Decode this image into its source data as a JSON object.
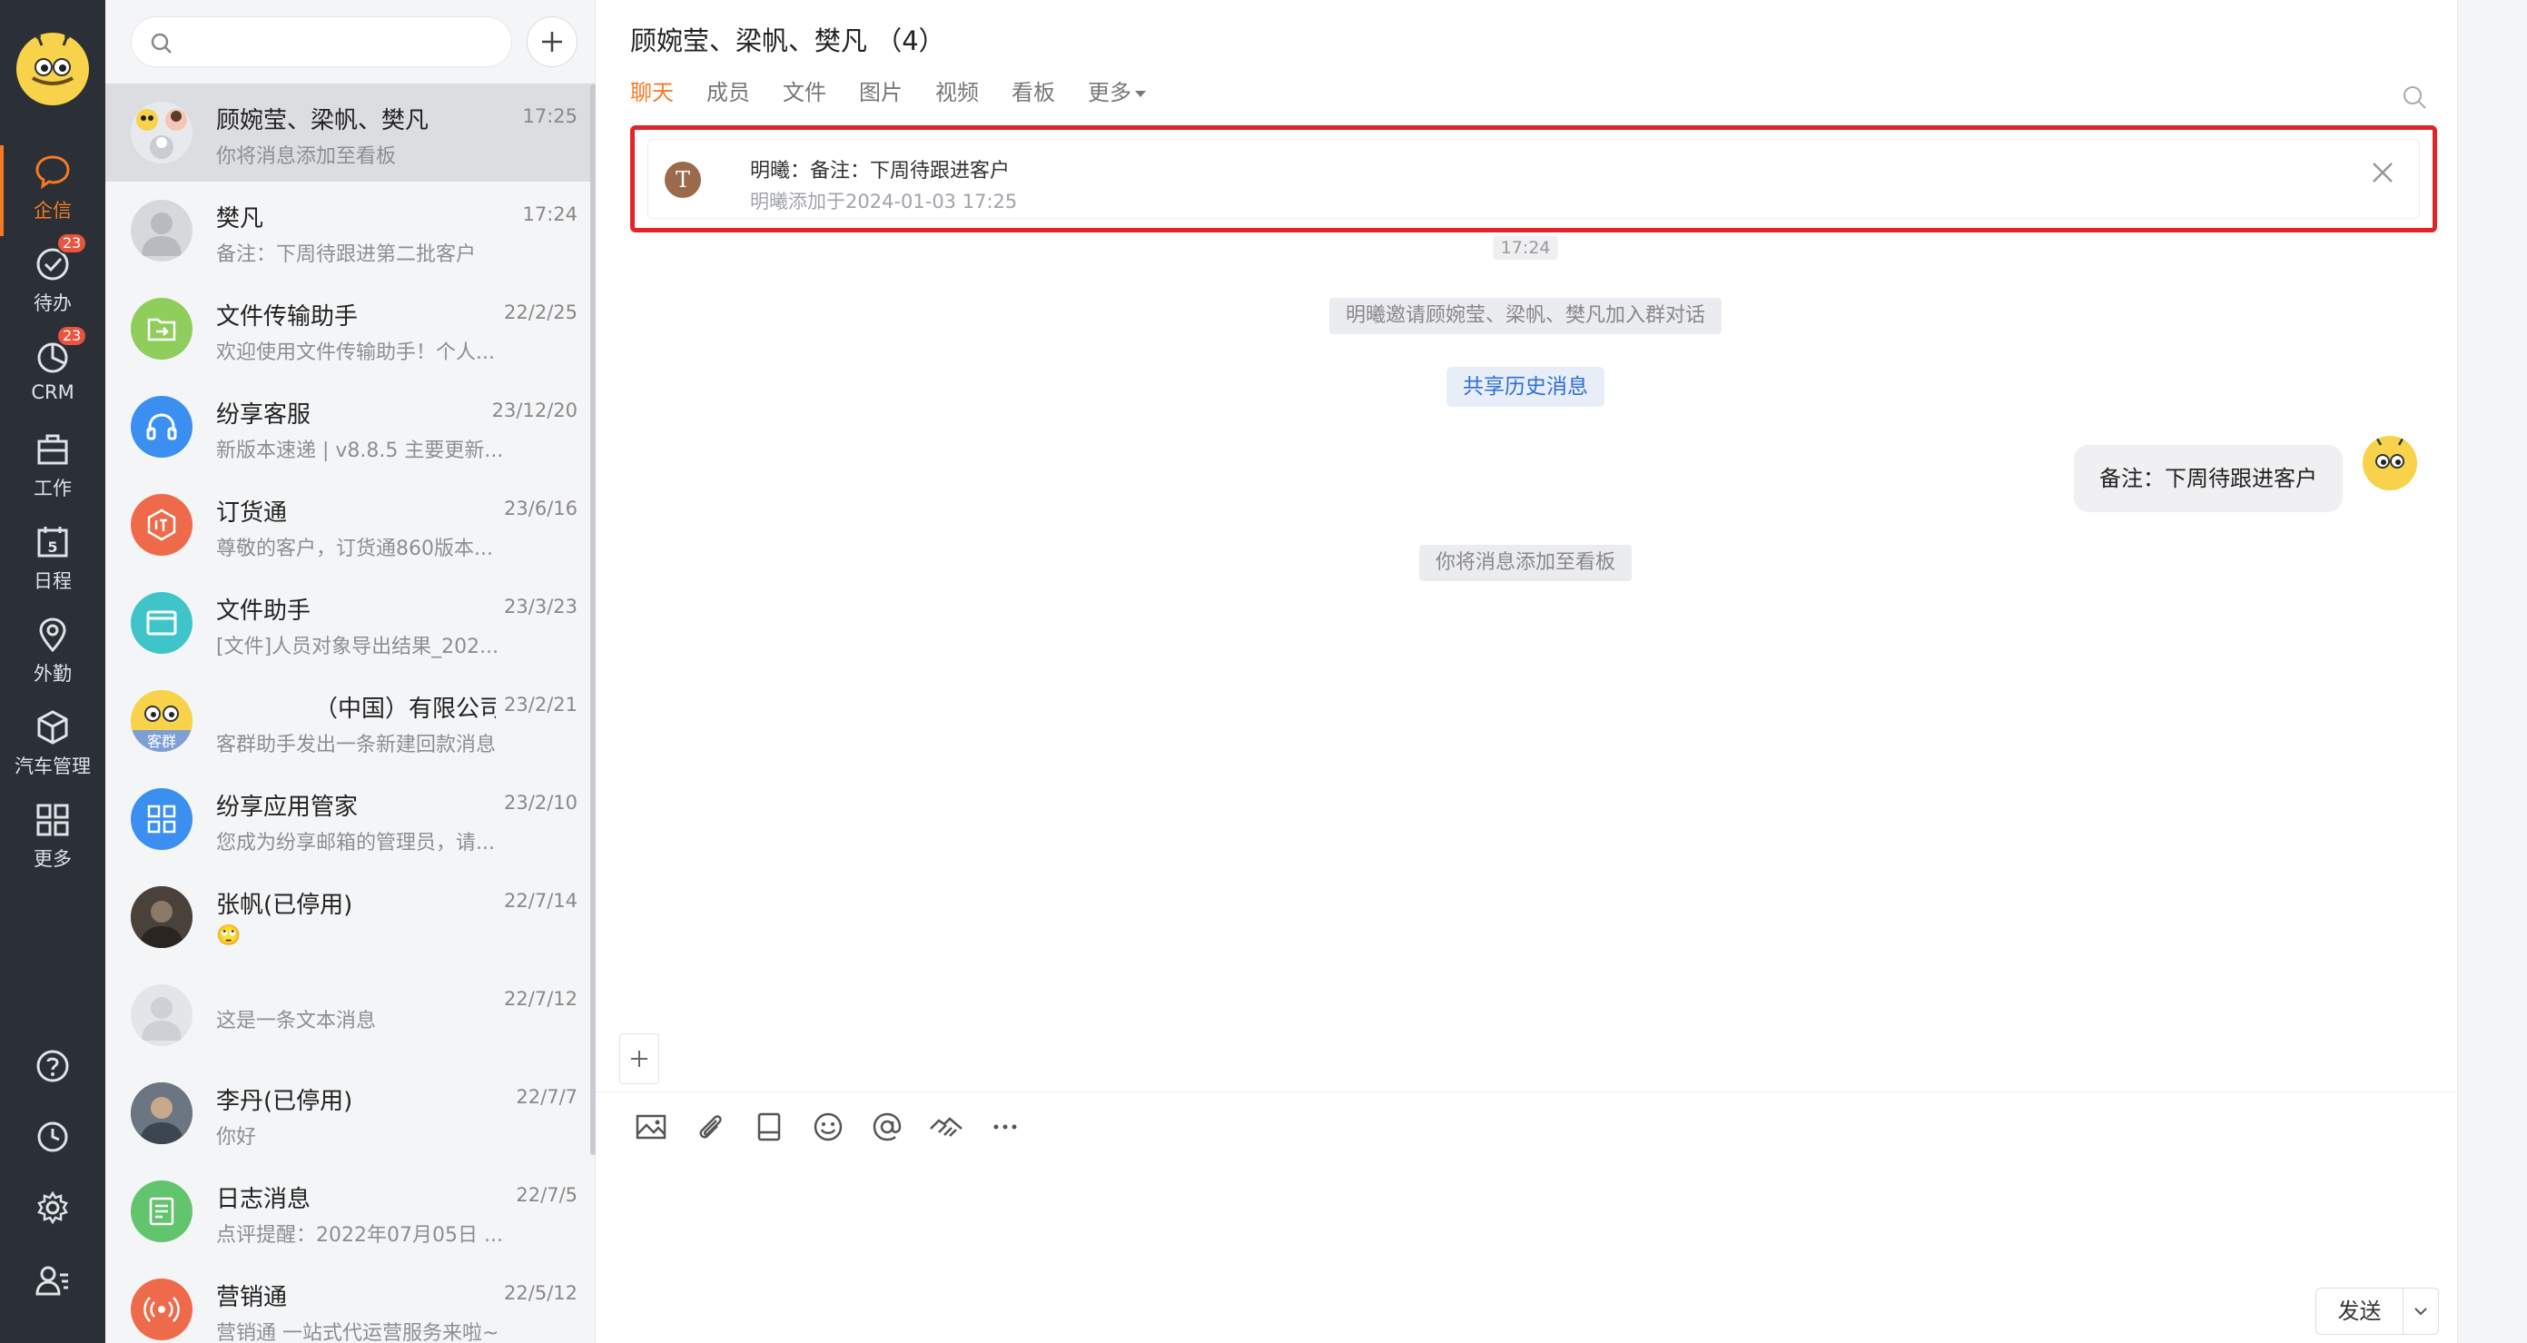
{
  "nav": {
    "items": [
      {
        "label": "企信",
        "icon": "chat-bubble-icon",
        "active": true
      },
      {
        "label": "待办",
        "icon": "check-circle-icon",
        "badge": "23"
      },
      {
        "label": "CRM",
        "icon": "pie-chart-icon",
        "badge": "23"
      },
      {
        "label": "工作",
        "icon": "briefcase-icon"
      },
      {
        "label": "日程",
        "icon": "calendar-icon",
        "day": "5"
      },
      {
        "label": "外勤",
        "icon": "location-pin-icon"
      },
      {
        "label": "汽车管理",
        "icon": "cube-icon"
      },
      {
        "label": "更多",
        "icon": "grid-icon"
      }
    ],
    "bottom": [
      {
        "icon": "help-icon"
      },
      {
        "icon": "clock-icon"
      },
      {
        "icon": "settings-icon"
      },
      {
        "icon": "user-list-icon"
      }
    ]
  },
  "search": {
    "placeholder": "",
    "value": ""
  },
  "conversations": [
    {
      "name": "顾婉莹、梁帆、樊凡",
      "time": "17:25",
      "preview": "你将消息添加至看板",
      "avatar": "group",
      "active": true
    },
    {
      "name": "樊凡",
      "time": "17:24",
      "preview": "备注：下周待跟进第二批客户",
      "avatar": "person-gray"
    },
    {
      "name": "文件传输助手",
      "time": "22/2/25",
      "preview": "欢迎使用文件传输助手！个人...",
      "avatar": "file-transfer",
      "color": "#8fce5d"
    },
    {
      "name": "纷享客服",
      "time": "23/12/20",
      "preview": "新版本速递 | v8.8.5 主要更新...",
      "avatar": "headset",
      "color": "#3b8ff0"
    },
    {
      "name": "订货通",
      "time": "23/6/16",
      "preview": "尊敬的客户，订货通860版本...",
      "avatar": "order",
      "color": "#ef6a4a"
    },
    {
      "name": "文件助手",
      "time": "23/3/23",
      "preview": "[文件]人员对象导出结果_202...",
      "avatar": "folder",
      "color": "#3fc5c9"
    },
    {
      "name": "（中国）有限公司",
      "time": "23/2/21",
      "preview": "客群助手发出一条新建回款消息",
      "avatar": "bee-group",
      "badge_text": "客群"
    },
    {
      "name": "纷享应用管家",
      "time": "23/2/10",
      "preview": "您成为纷享邮箱的管理员，请...",
      "avatar": "apps",
      "color": "#3b8ff0"
    },
    {
      "name": "张帆(已停用)",
      "time": "22/7/14",
      "preview": "",
      "avatar": "photo-dark",
      "emoji": "🙄"
    },
    {
      "name": "",
      "time": "22/7/12",
      "preview": "这是一条文本消息",
      "avatar": "person-light"
    },
    {
      "name": "李丹(已停用)",
      "time": "22/7/7",
      "preview": "你好",
      "avatar": "photo-person"
    },
    {
      "name": "日志消息",
      "time": "22/7/5",
      "preview": "点评提醒：2022年07月05日 ...",
      "avatar": "log",
      "color": "#62c46d"
    },
    {
      "name": "营销通",
      "time": "22/5/12",
      "preview": "营销通 一站式代运营服务来啦~",
      "avatar": "broadcast",
      "color": "#ef6a4a"
    }
  ],
  "chat": {
    "title": "顾婉莹、梁帆、樊凡 （4）",
    "tabs": [
      "聊天",
      "成员",
      "文件",
      "图片",
      "视频",
      "看板",
      "更多"
    ],
    "active_tab": "聊天",
    "pinned": {
      "avatar_letter": "T",
      "text": "明曦：备注：下周待跟进客户",
      "meta": "明曦添加于2024-01-03 17:25"
    },
    "timestamp": "17:24",
    "system_invite": "明曦邀请顾婉莹、梁帆、樊凡加入群对话",
    "share_history": "共享历史消息",
    "my_message": "备注：下周待跟进客户",
    "system_board": "你将消息添加至看板",
    "send_label": "发送",
    "toolbar": [
      "image-icon",
      "attachment-icon",
      "drive-icon",
      "emoji-icon",
      "mention-icon",
      "handshake-icon",
      "more-icon"
    ]
  },
  "colors": {
    "accent": "#f57a25",
    "highlight_border": "#e0242a",
    "nav_bg": "#2b2f36",
    "badge": "#e8543e",
    "link": "#2e6fd3"
  }
}
